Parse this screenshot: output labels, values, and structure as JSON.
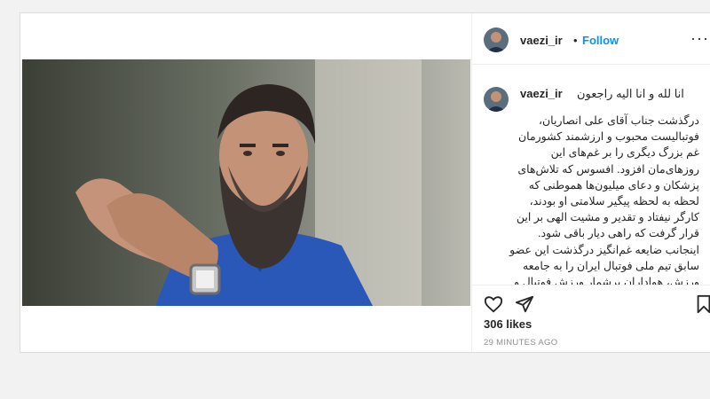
{
  "post": {
    "username": "vaezi_ir",
    "follow_separator": "•",
    "follow_label": "Follow",
    "more_label": "···",
    "caption_first_line": "انا لله و انا الیه راجعون",
    "caption_body": "درگذشت جناب آقای علی انصاریان، فوتبالیست محبوب و ارزشمند کشورمان غم بزرگ دیگری را بر غم‌های این روزهای‌مان افزود. افسوس که تلاش‌های پزشکان و دعای میلیون‌ها هموطنی که لحظه به لحظه پیگیر سلامتی او بودند، کارگر نیفتاد و تقدیر و مشیت الهی بر این قرار گرفت که راهی دیار باقی شود. اینجانب ضایعه غم‌انگیز درگذشت این عضو سابق تیم ملی فوتبال ایران را به جامعه ورزش، هواداران پرشمار ورزش فوتبال و خصوصا به خانواده آن مرحوم، بویژه مادر گرانقدرش تسلیت عرض می‌کنم و برای آن",
    "likes": "306 likes",
    "time": "29 MINUTES AGO"
  },
  "icons": {
    "avatar": "avatar-photo",
    "like": "heart-icon",
    "share": "paper-plane-icon",
    "save": "bookmark-icon",
    "more": "more-options-icon"
  },
  "colors": {
    "follow": "#0095f6",
    "text": "#262626",
    "muted": "#8e8e8e",
    "border": "#dbdbdb"
  }
}
